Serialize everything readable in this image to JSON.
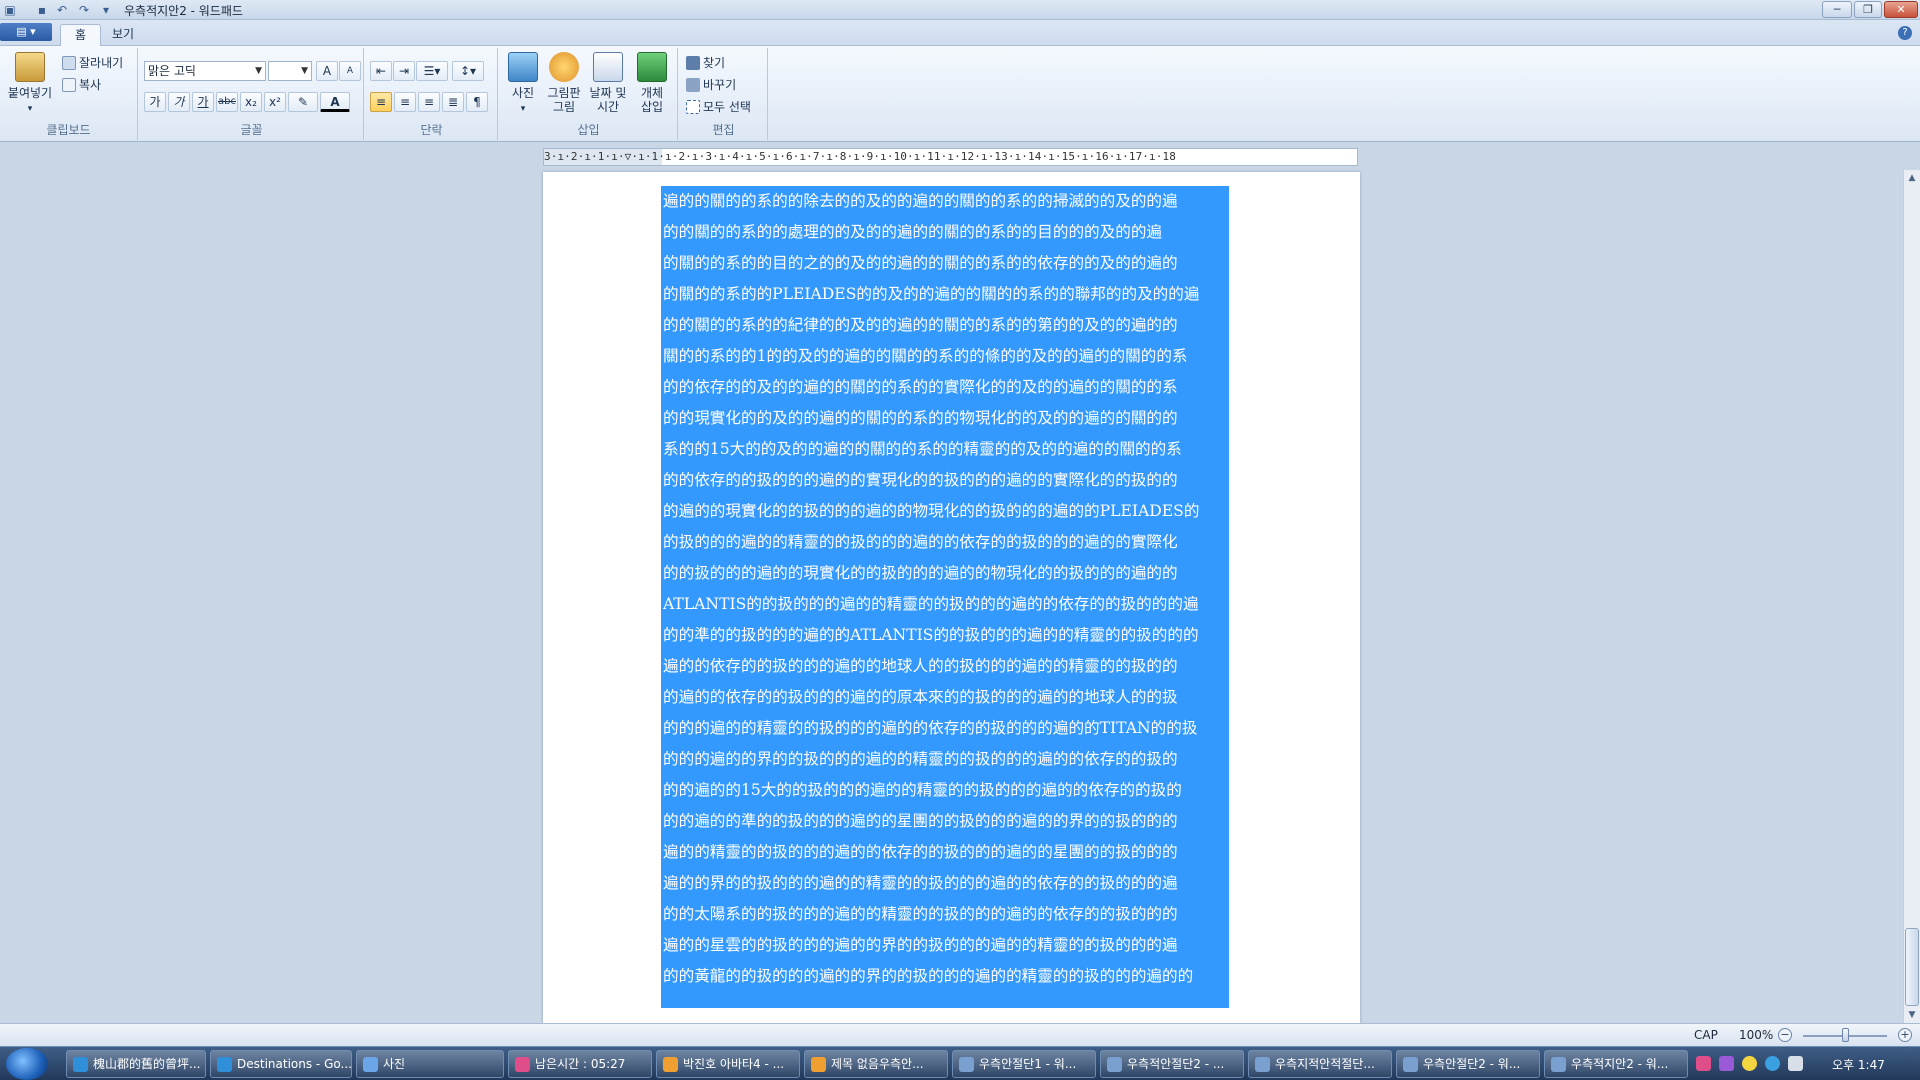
{
  "window": {
    "title": "우측적지안2 - 워드패드"
  },
  "ribbon_tabs": [
    {
      "label": "홈",
      "active": true
    },
    {
      "label": "보기",
      "active": false
    }
  ],
  "clipboard": {
    "group_label": "클립보드",
    "paste_label": "붙여넣기",
    "cut_label": "잘라내기",
    "copy_label": "복사"
  },
  "font": {
    "group_label": "글꼴",
    "font_name": "맑은 고딕",
    "font_size": "",
    "grow_label": "A",
    "shrink_label": "A",
    "bold_label": "가",
    "italic_label": "가",
    "underline_label": "가",
    "strike_label": "abc",
    "subscript_label": "x₂",
    "superscript_label": "x²",
    "highlight_label": "✎",
    "color_label": "A"
  },
  "paragraph": {
    "group_label": "단락"
  },
  "insert": {
    "group_label": "삽입",
    "picture_label": "사진",
    "paint_label_1": "그림판",
    "paint_label_2": "그림",
    "datetime_label_1": "날짜 및",
    "datetime_label_2": "시간",
    "object_label_1": "개체",
    "object_label_2": "삽입"
  },
  "editing": {
    "group_label": "편집",
    "find_label": "찾기",
    "replace_label": "바꾸기",
    "select_all_label": "모두 선택"
  },
  "ruler": {
    "text": "3·ı·2·ı·1·ı·▽·ı·1·ı·2·ı·3·ı·4·ı·5·ı·6·ı·7·ı·8·ı·9·ı·10·ı·11·ı·12·ı·13·ı·14·ı·15·ı·16·ı·17·ı·18"
  },
  "document": {
    "lines": [
      "遍的的關的的系的的除去的的及的的遍的的關的的系的的掃滅的的及的的遍",
      "的的關的的系的的處理的的及的的遍的的關的的系的的目的的的及的的遍",
      "的關的的系的的目的之的的及的的遍的的關的的系的的依存的的及的的遍的",
      "的關的的系的的PLEIADES的的及的的遍的的關的的系的的聯邦的的及的的遍",
      "的的關的的系的的紀律的的及的的遍的的關的的系的的第的的及的的遍的的",
      "關的的系的的1的的及的的遍的的關的的系的的條的的及的的遍的的關的的系",
      "的的依存的的及的的遍的的關的的系的的實際化的的及的的遍的的關的的系",
      "的的現實化的的及的的遍的的關的的系的的物現化的的及的的遍的的關的的",
      "系的的15大的的及的的遍的的關的的系的的精靈的的及的的遍的的關的的系",
      "的的依存的的扱的的的遍的的實現化的的扱的的的遍的的實際化的的扱的的",
      "的遍的的現實化的的扱的的的遍的的物現化的的扱的的的遍的的PLEIADES的",
      "的扱的的的遍的的精靈的的扱的的的遍的的依存的的扱的的的遍的的實際化",
      "的的扱的的的遍的的現實化的的扱的的的遍的的物現化的的扱的的的遍的的",
      "ATLANTIS的的扱的的的遍的的精靈的的扱的的的遍的的依存的的扱的的的遍",
      "的的準的的扱的的的遍的的ATLANTIS的的扱的的的遍的的精靈的的扱的的的",
      "遍的的依存的的扱的的的遍的的地球人的的扱的的的遍的的精靈的的扱的的",
      "的遍的的依存的的扱的的的遍的的原本來的的扱的的的遍的的地球人的的扱",
      "的的的遍的的精靈的的扱的的的遍的的依存的的扱的的的遍的的TITAN的的扱",
      "的的的遍的的界的的扱的的的遍的的精靈的的扱的的的遍的的依存的的扱的",
      "的的遍的的15大的的扱的的的遍的的精靈的的扱的的的遍的的依存的的扱的",
      "的的遍的的準的的扱的的的遍的的星團的的扱的的的遍的的界的的扱的的的",
      "遍的的精靈的的扱的的的遍的的依存的的扱的的的遍的的星團的的扱的的的",
      "遍的的界的的扱的的的遍的的精靈的的扱的的的遍的的依存的的扱的的的遍",
      "的的太陽系的的扱的的的遍的的精靈的的扱的的的遍的的依存的的扱的的的",
      "遍的的星雲的的扱的的的遍的的界的的扱的的的遍的的精靈的的扱的的的遍",
      "的的黃龍的的扱的的的遍的的界的的扱的的的遍的的精靈的的扱的的的遍的的"
    ]
  },
  "statusbar": {
    "caps": "CAP",
    "zoom": "100%",
    "zoom_level_percent": 100
  },
  "taskbar": {
    "tasks": [
      {
        "label": "槐山郡的舊的曾坪...",
        "color": "#2f8fd8"
      },
      {
        "label": "Destinations - Go...",
        "color": "#2f8fd8"
      },
      {
        "label": "사진",
        "color": "#6aa6e8"
      },
      {
        "label": "남은시간 : 05:27",
        "color": "#e04e8a"
      },
      {
        "label": "박진호 아바타4 - ...",
        "color": "#f0a030"
      },
      {
        "label": "제목 없음우측안...",
        "color": "#f0a030"
      },
      {
        "label": "우측안절단1 - 워...",
        "color": "#7aa0d0"
      },
      {
        "label": "우측적안절단2 - ...",
        "color": "#7aa0d0"
      },
      {
        "label": "우측지적안적절단...",
        "color": "#7aa0d0"
      },
      {
        "label": "우측안절단2 - 워...",
        "color": "#7aa0d0"
      },
      {
        "label": "우측적지안2 - 워...",
        "color": "#7aa0d0"
      }
    ],
    "clock": "오후 1:47"
  },
  "colors": {
    "selection": "#3399ff",
    "ribbon_bg": "#dce7f4",
    "taskbar_bg": "#22385a"
  }
}
